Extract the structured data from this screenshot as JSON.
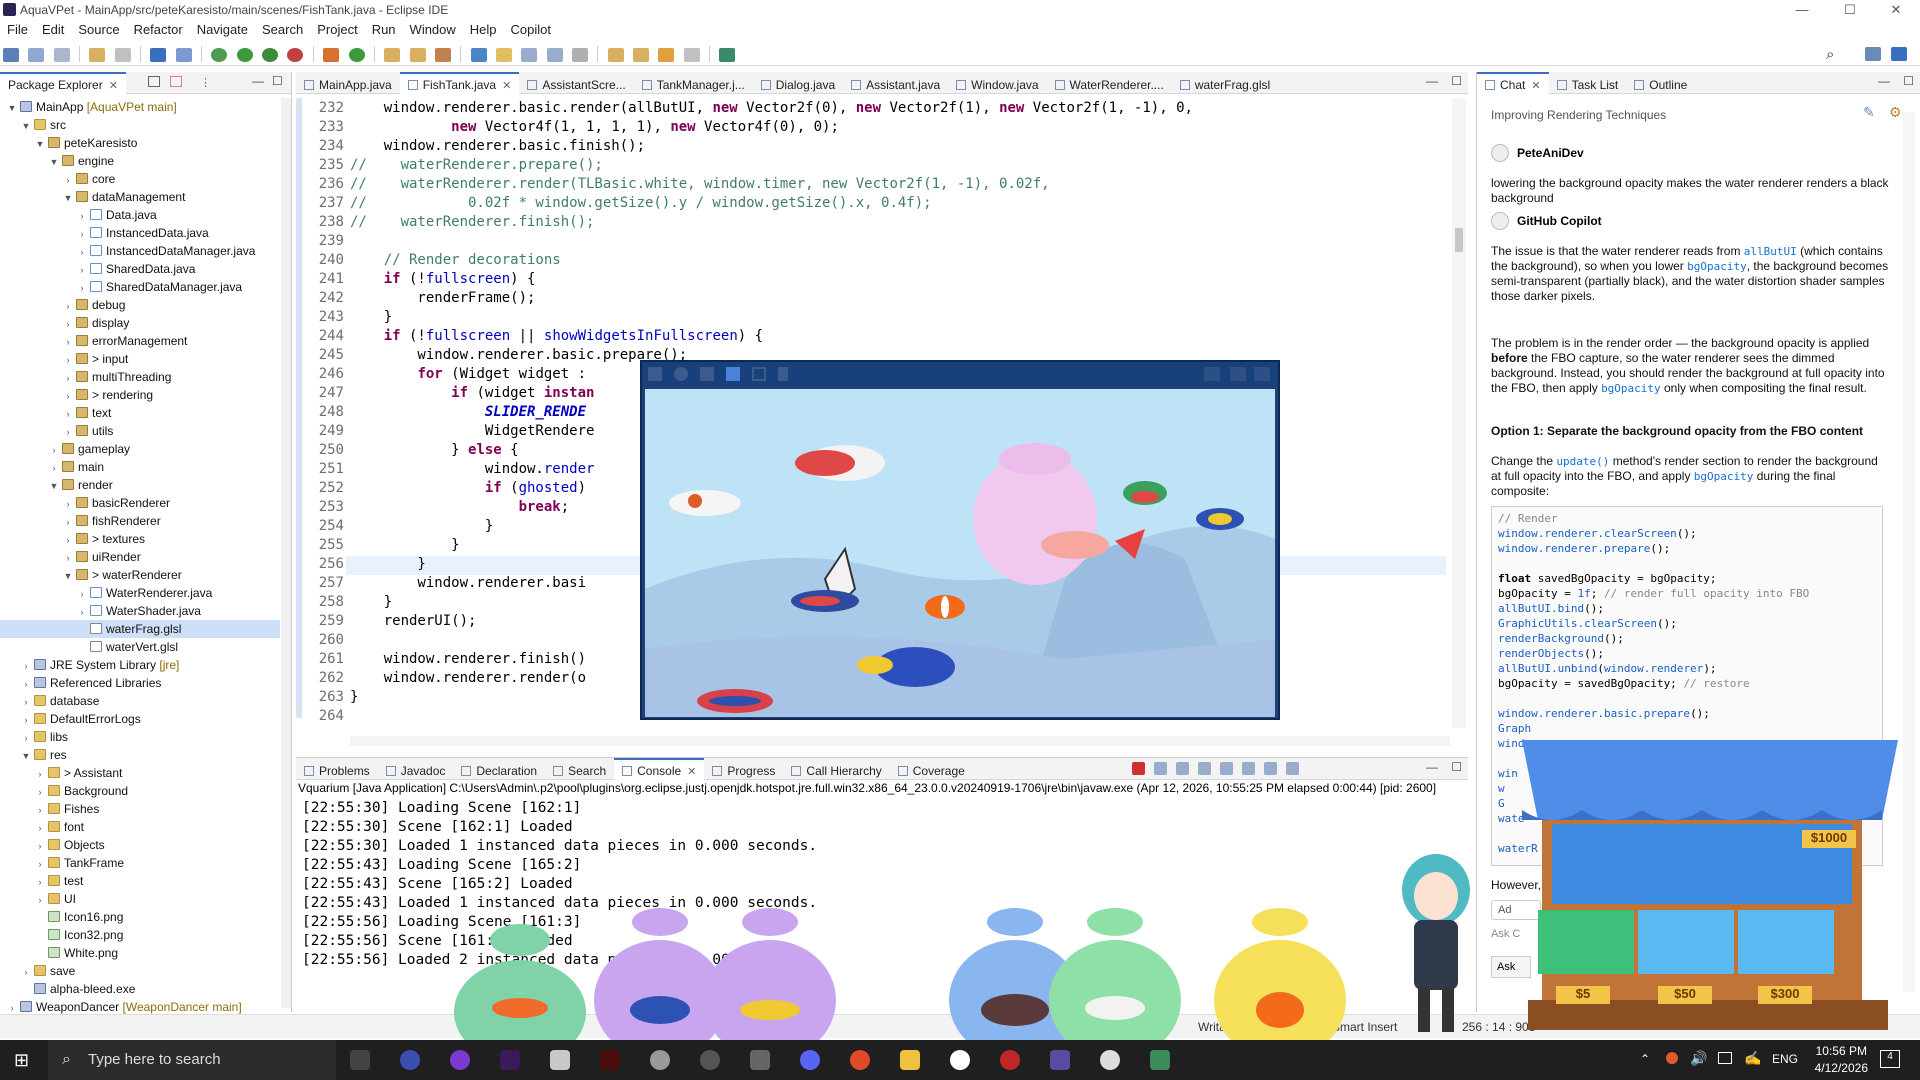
{
  "window": {
    "title": "AquaVPet - MainApp/src/peteKaresisto/main/scenes/FishTank.java - Eclipse IDE",
    "minimize": "—",
    "maximize": "☐",
    "close": "✕"
  },
  "menu": [
    "File",
    "Edit",
    "Source",
    "Refactor",
    "Navigate",
    "Search",
    "Project",
    "Run",
    "Window",
    "Help",
    "Copilot"
  ],
  "package_explorer": {
    "tab_label": "Package Explorer",
    "tree": [
      {
        "d": 0,
        "arrow": "▼",
        "icon": "ic-lib",
        "label": "MainApp",
        "suffix": " [AquaVPet main]"
      },
      {
        "d": 1,
        "arrow": "▼",
        "icon": "ic-fold",
        "label": "src",
        "suffix": ""
      },
      {
        "d": 2,
        "arrow": "▼",
        "icon": "ic-pkg",
        "label": "peteKaresisto",
        "suffix": ""
      },
      {
        "d": 3,
        "arrow": "▼",
        "icon": "ic-pkg",
        "label": "engine",
        "suffix": ""
      },
      {
        "d": 4,
        "arrow": "›",
        "icon": "ic-pkg",
        "label": "core",
        "suffix": ""
      },
      {
        "d": 4,
        "arrow": "▼",
        "icon": "ic-pkg",
        "label": "dataManagement",
        "suffix": ""
      },
      {
        "d": 5,
        "arrow": "›",
        "icon": "ic-java",
        "label": "Data.java",
        "suffix": ""
      },
      {
        "d": 5,
        "arrow": "›",
        "icon": "ic-java",
        "label": "InstancedData.java",
        "suffix": ""
      },
      {
        "d": 5,
        "arrow": "›",
        "icon": "ic-java",
        "label": "InstancedDataManager.java",
        "suffix": ""
      },
      {
        "d": 5,
        "arrow": "›",
        "icon": "ic-java",
        "label": "SharedData.java",
        "suffix": ""
      },
      {
        "d": 5,
        "arrow": "›",
        "icon": "ic-java",
        "label": "SharedDataManager.java",
        "suffix": ""
      },
      {
        "d": 4,
        "arrow": "›",
        "icon": "ic-pkg",
        "label": "debug",
        "suffix": ""
      },
      {
        "d": 4,
        "arrow": "›",
        "icon": "ic-pkg",
        "label": "display",
        "suffix": ""
      },
      {
        "d": 4,
        "arrow": "›",
        "icon": "ic-pkg",
        "label": "errorManagement",
        "suffix": ""
      },
      {
        "d": 4,
        "arrow": "›",
        "icon": "ic-pkg",
        "label": "> input",
        "suffix": ""
      },
      {
        "d": 4,
        "arrow": "›",
        "icon": "ic-pkg",
        "label": "multiThreading",
        "suffix": ""
      },
      {
        "d": 4,
        "arrow": "›",
        "icon": "ic-pkg",
        "label": "> rendering",
        "suffix": ""
      },
      {
        "d": 4,
        "arrow": "›",
        "icon": "ic-pkg",
        "label": "text",
        "suffix": ""
      },
      {
        "d": 4,
        "arrow": "›",
        "icon": "ic-pkg",
        "label": "utils",
        "suffix": ""
      },
      {
        "d": 3,
        "arrow": "›",
        "icon": "ic-pkg",
        "label": "gameplay",
        "suffix": ""
      },
      {
        "d": 3,
        "arrow": "›",
        "icon": "ic-pkg",
        "label": "main",
        "suffix": ""
      },
      {
        "d": 3,
        "arrow": "▼",
        "icon": "ic-pkg",
        "label": "render",
        "suffix": ""
      },
      {
        "d": 4,
        "arrow": "›",
        "icon": "ic-pkg",
        "label": "basicRenderer",
        "suffix": ""
      },
      {
        "d": 4,
        "arrow": "›",
        "icon": "ic-pkg",
        "label": "fishRenderer",
        "suffix": ""
      },
      {
        "d": 4,
        "arrow": "›",
        "icon": "ic-pkg",
        "label": "> textures",
        "suffix": ""
      },
      {
        "d": 4,
        "arrow": "›",
        "icon": "ic-pkg",
        "label": "uiRender",
        "suffix": ""
      },
      {
        "d": 4,
        "arrow": "▼",
        "icon": "ic-pkg",
        "label": "> waterRenderer",
        "suffix": ""
      },
      {
        "d": 5,
        "arrow": "›",
        "icon": "ic-java",
        "label": "WaterRenderer.java",
        "suffix": ""
      },
      {
        "d": 5,
        "arrow": "›",
        "icon": "ic-java",
        "label": "WaterShader.java",
        "suffix": ""
      },
      {
        "d": 5,
        "arrow": "",
        "icon": "ic-glsl",
        "label": "waterFrag.glsl",
        "suffix": "",
        "sel": true
      },
      {
        "d": 5,
        "arrow": "",
        "icon": "ic-glsl",
        "label": "waterVert.glsl",
        "suffix": ""
      },
      {
        "d": 1,
        "arrow": "›",
        "icon": "ic-lib",
        "label": "JRE System Library",
        "suffix": " [jre]"
      },
      {
        "d": 1,
        "arrow": "›",
        "icon": "ic-lib",
        "label": "Referenced Libraries",
        "suffix": ""
      },
      {
        "d": 1,
        "arrow": "›",
        "icon": "ic-fold",
        "label": "database",
        "suffix": ""
      },
      {
        "d": 1,
        "arrow": "›",
        "icon": "ic-fold",
        "label": "DefaultErrorLogs",
        "suffix": ""
      },
      {
        "d": 1,
        "arrow": "›",
        "icon": "ic-fold",
        "label": "libs",
        "suffix": ""
      },
      {
        "d": 1,
        "arrow": "▼",
        "icon": "ic-fold",
        "label": "res",
        "suffix": ""
      },
      {
        "d": 2,
        "arrow": "›",
        "icon": "ic-fold",
        "label": "> Assistant",
        "suffix": ""
      },
      {
        "d": 2,
        "arrow": "›",
        "icon": "ic-fold",
        "label": "Background",
        "suffix": ""
      },
      {
        "d": 2,
        "arrow": "›",
        "icon": "ic-fold",
        "label": "Fishes",
        "suffix": ""
      },
      {
        "d": 2,
        "arrow": "›",
        "icon": "ic-fold",
        "label": "font",
        "suffix": ""
      },
      {
        "d": 2,
        "arrow": "›",
        "icon": "ic-fold",
        "label": "Objects",
        "suffix": ""
      },
      {
        "d": 2,
        "arrow": "›",
        "icon": "ic-fold",
        "label": "TankFrame",
        "suffix": ""
      },
      {
        "d": 2,
        "arrow": "›",
        "icon": "ic-fold",
        "label": "test",
        "suffix": ""
      },
      {
        "d": 2,
        "arrow": "›",
        "icon": "ic-fold",
        "label": "UI",
        "suffix": ""
      },
      {
        "d": 2,
        "arrow": "",
        "icon": "ic-png",
        "label": "Icon16.png",
        "suffix": ""
      },
      {
        "d": 2,
        "arrow": "",
        "icon": "ic-png",
        "label": "Icon32.png",
        "suffix": ""
      },
      {
        "d": 2,
        "arrow": "",
        "icon": "ic-png",
        "label": "White.png",
        "suffix": ""
      },
      {
        "d": 1,
        "arrow": "›",
        "icon": "ic-fold",
        "label": "save",
        "suffix": ""
      },
      {
        "d": 1,
        "arrow": "",
        "icon": "ic-lib",
        "label": "alpha-bleed.exe",
        "suffix": ""
      },
      {
        "d": 0,
        "arrow": "›",
        "icon": "ic-lib",
        "label": "WeaponDancer",
        "suffix": " [WeaponDancer main]"
      }
    ]
  },
  "editor": {
    "tabs": [
      "MainApp.java",
      "FishTank.java",
      "AssistantScre...",
      "TankManager.j...",
      "Dialog.java",
      "Assistant.java",
      "Window.java",
      "WaterRenderer....",
      "waterFrag.glsl"
    ],
    "active_tab": 1,
    "lines": [
      {
        "n": "232",
        "html": "    window.renderer.basic.render(allButUI, <span class=\"kw\">new</span> Vector2f(0), <span class=\"kw\">new</span> Vector2f(1), <span class=\"kw\">new</span> Vector2f(1, -1), 0,"
      },
      {
        "n": "233",
        "html": "            <span class=\"kw\">new</span> Vector4f(1, 1, 1, 1), <span class=\"kw\">new</span> Vector4f(0), 0);"
      },
      {
        "n": "234",
        "html": "    window.renderer.basic.finish();"
      },
      {
        "n": "235",
        "html": "<span class=\"cm\">//    waterRenderer.prepare();</span>"
      },
      {
        "n": "236",
        "html": "<span class=\"cm\">//    waterRenderer.render(TLBasic.white, window.timer, new Vector2f(1, -1), 0.02f,</span>"
      },
      {
        "n": "237",
        "html": "<span class=\"cm\">//            0.02f * window.getSize().y / window.getSize().x, 0.4f);</span>"
      },
      {
        "n": "238",
        "html": "<span class=\"cm\">//    waterRenderer.finish();</span>"
      },
      {
        "n": "239",
        "html": ""
      },
      {
        "n": "240",
        "html": "    <span class=\"cm\">// Render decorations</span>"
      },
      {
        "n": "241",
        "html": "    <span class=\"kw\">if</span> (!<span class=\"fd\">fullscreen</span>) {"
      },
      {
        "n": "242",
        "html": "        renderFrame();"
      },
      {
        "n": "243",
        "html": "    }"
      },
      {
        "n": "244",
        "html": "    <span class=\"kw\">if</span> (!<span class=\"fd\">fullscreen</span> || <span class=\"fd\">showWidgetsInFullscreen</span>) {"
      },
      {
        "n": "245",
        "html": "        window.renderer.basic.prepare();"
      },
      {
        "n": "246",
        "html": "        <span class=\"kw\">for</span> (Widget widget :"
      },
      {
        "n": "247",
        "html": "            <span class=\"kw\">if</span> (widget <span class=\"kw\">instan</span>"
      },
      {
        "n": "248",
        "html": "                <span class=\"it\">SLIDER_RENDE</span>"
      },
      {
        "n": "249",
        "html": "                WidgetRendere"
      },
      {
        "n": "250",
        "html": "            } <span class=\"kw\">else</span> {"
      },
      {
        "n": "251",
        "html": "                window.<span class=\"fd\">render</span>"
      },
      {
        "n": "252",
        "html": "                <span class=\"kw\">if</span> (<span class=\"fd\">ghosted</span>)"
      },
      {
        "n": "253",
        "html": "                    <span class=\"kw\">break</span>;"
      },
      {
        "n": "254",
        "html": "                }"
      },
      {
        "n": "255",
        "html": "            }"
      },
      {
        "n": "256",
        "html": "        }"
      },
      {
        "n": "257",
        "html": "        window.renderer.basi"
      },
      {
        "n": "258",
        "html": "    }"
      },
      {
        "n": "259",
        "html": "    renderUI();"
      },
      {
        "n": "260",
        "html": ""
      },
      {
        "n": "261",
        "html": "    window.renderer.finish()"
      },
      {
        "n": "262",
        "html": "    window.renderer.render(o"
      },
      {
        "n": "263",
        "html": "}"
      },
      {
        "n": "264",
        "html": ""
      }
    ]
  },
  "console": {
    "tabs": [
      "Problems",
      "Javadoc",
      "Declaration",
      "Search",
      "Console",
      "Progress",
      "Call Hierarchy",
      "Coverage"
    ],
    "active_tab": 4,
    "path": "Vquarium [Java Application] C:\\Users\\Admin\\.p2\\pool\\plugins\\org.eclipse.justj.openjdk.hotspot.jre.full.win32.x86_64_23.0.0.v20240919-1706\\jre\\bin\\javaw.exe  (Apr 12, 2026, 10:55:25 PM elapsed 0:00:44) [pid: 2600]",
    "lines": [
      "[22:55:30] Loading Scene [162:1]",
      "[22:55:30] Scene [162:1] Loaded",
      "[22:55:30] Loaded 1 instanced data pieces in 0.000 seconds.",
      "[22:55:43] Loading Scene [165:2]",
      "[22:55:43] Scene [165:2] Loaded",
      "[22:55:43] Loaded 1 instanced data pieces in 0.000 seconds.",
      "[22:55:56] Loading Scene [161:3]",
      "[22:55:56] Scene [161:3] Loaded",
      "[22:55:56] Loaded 2 instanced data pieces in 0.000 seconds."
    ]
  },
  "chat": {
    "tabs": [
      "Chat",
      "Task List",
      "Outline"
    ],
    "topic": "Improving Rendering Techniques",
    "user_name": "PeteAniDev",
    "user_msg": "lowering the background opacity makes the water renderer renders a black background",
    "bot_name": "GitHub Copilot",
    "p1": "The issue is that the water renderer reads from <span class=\"ilc\">allButUI</span> (which contains the background), so when you lower <span class=\"ilc\">bgOpacity</span>, the background becomes semi-transparent (partially black), and the water distortion shader samples those darker pixels.",
    "p2": "The problem is in the render order — the background opacity is applied <b>before</b> the FBO capture, so the water renderer sees the dimmed background. Instead, you should render the background at full opacity into the FBO, then apply <span class=\"ilc\">bgOpacity</span> only when compositing the final result.",
    "option_heading": "Option 1: Separate the background opacity from the FBO content",
    "p3": "Change the <span class=\"ilc\">update()</span> method's render section to render the background at full opacity into the FBO, and apply <span class=\"ilc\">bgOpacity</span> during the final composite:",
    "code": "<span class=\"cb-c\">// Render</span>\n<span class=\"cb-b\">window.renderer.clearScreen</span>();\n<span class=\"cb-b\">window.renderer.prepare</span>();\n\n<b>float</b> savedBgOpacity = bgOpacity;\nbgOpacity = <span class=\"cb-b\">1f</span>; <span class=\"cb-c\">// render full opacity into FBO</span>\n<span class=\"cb-b\">allButUI.bind</span>();\n<span class=\"cb-b\">GraphicUtils.clearScreen</span>();\n<span class=\"cb-b\">renderBackground</span>();\n<span class=\"cb-b\">renderObjects</span>();\n<span class=\"cb-b\">allButUI.unbind</span>(<span class=\"cb-b\">window.renderer</span>);\nbgOpacity = savedBgOpacity; <span class=\"cb-c\">// restore</span>\n\n<span class=\"cb-b\">window.renderer.basic.prepare</span>();\n<span class=\"cb-b\">Graph</span>\n<span class=\"cb-b\">windo</span>\n\n<span class=\"cb-b\">win</span>\n<span class=\"cb-b\">w</span>\n<span class=\"cb-b\">G</span>\n<span class=\"cb-b\">wate</span>\n\n<span class=\"cb-b\">waterR</span>",
    "however": "However,",
    "ask_placeholder": "Ask C",
    "ask2": "Ask",
    "add_label": "Ad"
  },
  "status": {
    "writable": "Writable",
    "insert": "Smart Insert",
    "pos": "256 : 14 : 903"
  },
  "shop": {
    "price_top": "$1000",
    "prices": [
      "$5",
      "$50",
      "$300"
    ]
  },
  "taskbar": {
    "search": "Type here to search",
    "lang": "ENG",
    "time": "10:56 PM",
    "date": "4/12/2026",
    "notif": "4"
  },
  "colors": {
    "accent": "#3a6ec0",
    "keyword": "#7f0055",
    "comment": "#3f7f5f"
  }
}
